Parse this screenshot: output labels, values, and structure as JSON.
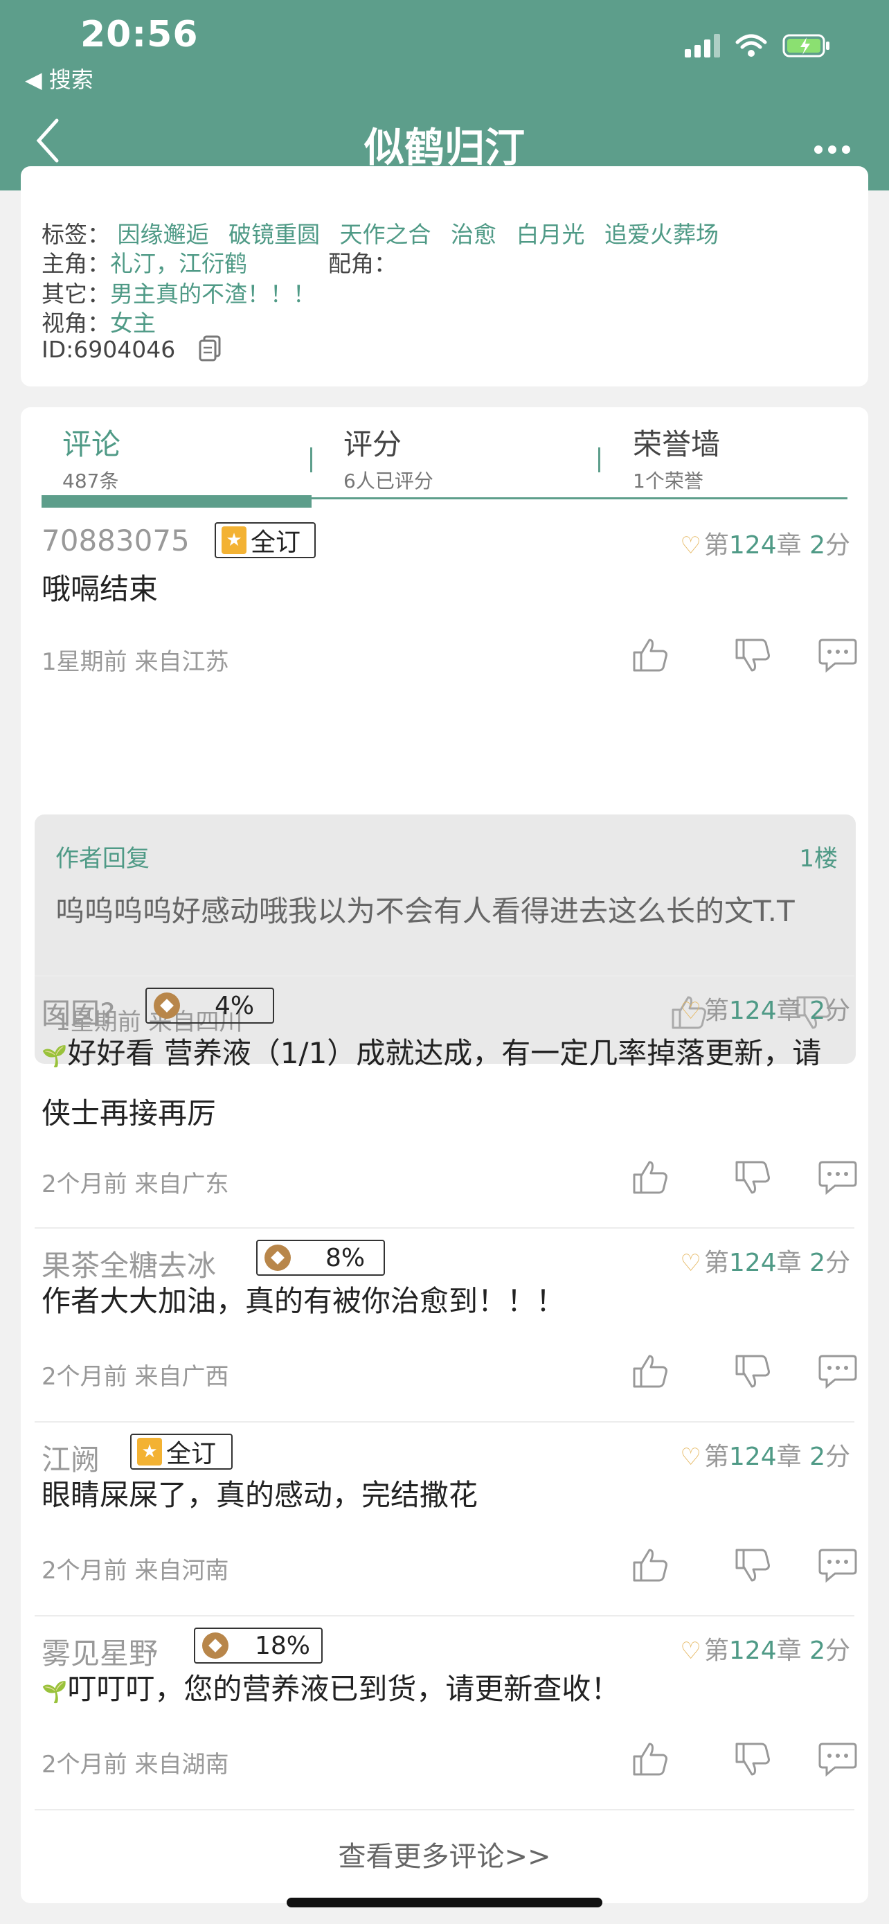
{
  "status": {
    "time": "20:56",
    "back_app": "◀ 搜索"
  },
  "nav": {
    "title": "似鹤归汀",
    "back_icon": "chevron-left-icon",
    "more_icon": "more-dots-icon"
  },
  "info": {
    "tags_label": "标签：",
    "tags": [
      "因缘邂逅",
      "破镜重圆",
      "天作之合",
      "治愈",
      "白月光",
      "追爱火葬场"
    ],
    "lead_label": "主角：",
    "lead_value": "礼汀，江衍鹤",
    "support_label": "配角：",
    "other_label": "其它：",
    "other_value": "男主真的不渣！！！",
    "view_label": "视角：",
    "view_value": "女主",
    "id_text": "ID:6904046"
  },
  "tabs": [
    {
      "label": "评论",
      "sub": "487条"
    },
    {
      "label": "评分",
      "sub": "6人已评分"
    },
    {
      "label": "荣誉墙",
      "sub": "1个荣誉"
    }
  ],
  "comments": [
    {
      "user": "70883075",
      "badge": "全订",
      "badge_type": "subscribe",
      "chapter_prefix": "第",
      "chapter_num": "124",
      "chapter_mid": "章",
      "score_num": "2",
      "score_unit": "分",
      "text": "哦嗝结束",
      "time": "1星期前",
      "location": "来自江苏"
    },
    {
      "user": "囡囡?",
      "badge": "4%",
      "badge_type": "coin",
      "chapter_prefix": "第",
      "chapter_num": "124",
      "chapter_mid": "章",
      "score_num": "2",
      "score_unit": "分",
      "text": "好好看  营养液（1/1）成就达成，有一定几率掉落更新，请侠士再接再厉",
      "time": "2个月前",
      "location": "来自广东"
    },
    {
      "user": "果茶全糖去冰",
      "badge": "8%",
      "badge_type": "coin",
      "chapter_prefix": "第",
      "chapter_num": "124",
      "chapter_mid": "章",
      "score_num": "2",
      "score_unit": "分",
      "text": "作者大大加油，真的有被你治愈到！！！",
      "time": "2个月前",
      "location": "来自广西"
    },
    {
      "user": "江阙",
      "badge": "全订",
      "badge_type": "subscribe",
      "chapter_prefix": "第",
      "chapter_num": "124",
      "chapter_mid": "章",
      "score_num": "2",
      "score_unit": "分",
      "text": "眼睛屎屎了，真的感动，完结撒花",
      "time": "2个月前",
      "location": "来自河南"
    },
    {
      "user": "雾见星野",
      "badge": "18%",
      "badge_type": "coin",
      "chapter_prefix": "第",
      "chapter_num": "124",
      "chapter_mid": "章",
      "score_num": "2",
      "score_unit": "分",
      "text": "叮叮叮，您的营养液已到货，请更新查收！",
      "time": "2个月前",
      "location": "来自湖南"
    }
  ],
  "reply": {
    "label": "作者回复",
    "floor": "1楼",
    "text": "呜呜呜呜好感动哦我以为不会有人看得进去这么长的文T.T",
    "time": "1星期前",
    "location": "来自四川"
  },
  "more_comments": "查看更多评论>>",
  "colors": {
    "brand": "#5d9e8b",
    "accent_text": "#4f9a86",
    "badge_gold": "#f3b233"
  }
}
